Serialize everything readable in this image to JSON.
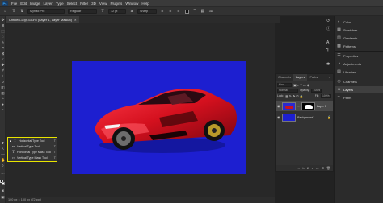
{
  "menubar": {
    "logo": "Ps",
    "items": [
      "File",
      "Edit",
      "Image",
      "Layer",
      "Type",
      "Select",
      "Filter",
      "3D",
      "View",
      "Plugins",
      "Window",
      "Help"
    ]
  },
  "options": {
    "font_family": "Myriad Pro",
    "font_style": "Regular",
    "font_size": "12 pt",
    "antialias": "Sharp",
    "aa_label": "a"
  },
  "document": {
    "tab_title": "Untitled-1 @ 33.3% (Layer 1, Layer Mask/8)",
    "status": "100 px × 100 px (72 ppi)"
  },
  "canvas": {
    "background_color": "#1d1fd0"
  },
  "type_flyout": {
    "items": [
      {
        "label": "Horizontal Type Tool",
        "shortcut": "T",
        "icon": "T"
      },
      {
        "label": "Vertical Type Tool",
        "shortcut": "T",
        "icon": "IT"
      },
      {
        "label": "Horizontal Type Mask Tool",
        "shortcut": "T",
        "icon": "T"
      },
      {
        "label": "Vertical Type Mask Tool",
        "shortcut": "T",
        "icon": "IT"
      }
    ]
  },
  "layers_panel": {
    "tabs": [
      "Channels",
      "Layers",
      "Paths"
    ],
    "active_tab": "Layers",
    "kind": "Kind",
    "blend_mode": "Normal",
    "opacity_label": "Opacity:",
    "opacity": "100%",
    "fill_label": "Fill:",
    "fill": "100%",
    "lock_label": "Lock:",
    "layers": [
      {
        "name": "Layer 1"
      },
      {
        "name": "Background"
      }
    ]
  },
  "dock": {
    "items": [
      "Color",
      "Swatches",
      "Gradients",
      "Patterns",
      "Properties",
      "Adjustments",
      "Libraries",
      "Channels",
      "Layers",
      "Paths"
    ],
    "active": "Layers"
  }
}
